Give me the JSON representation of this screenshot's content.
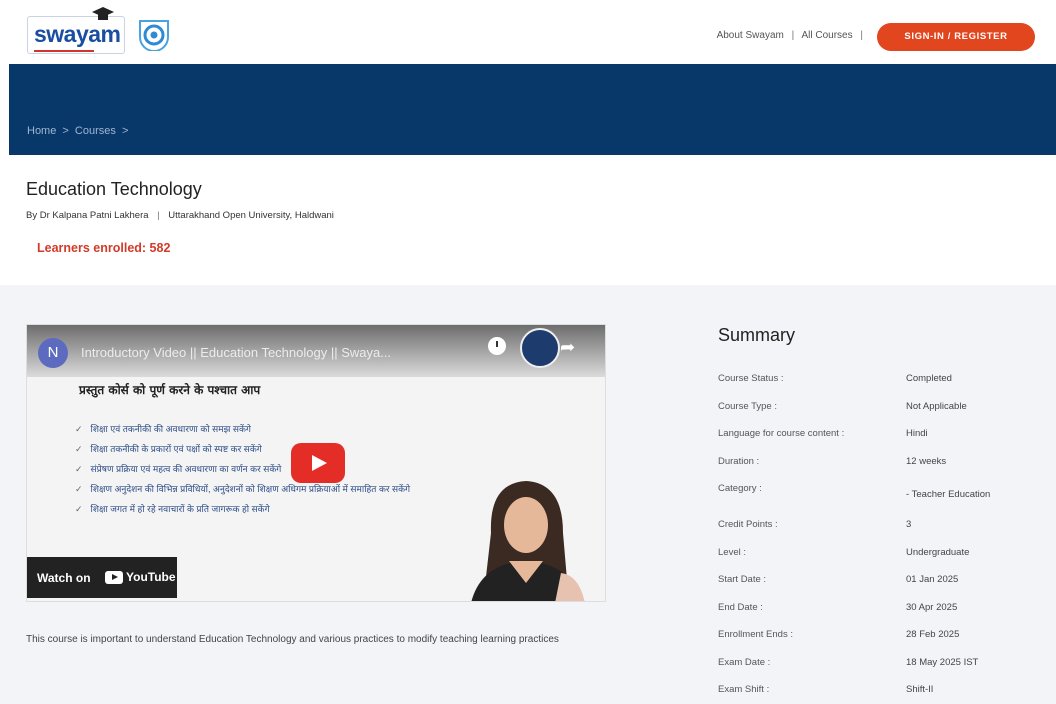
{
  "header": {
    "logo_text": "swayam",
    "nav_about": "About Swayam",
    "nav_sep": "|",
    "nav_courses": "All Courses",
    "signin_label": "SIGN-IN / REGISTER"
  },
  "breadcrumb": {
    "home": "Home",
    "sep1": ">",
    "courses": "Courses",
    "sep2": ">"
  },
  "course": {
    "title": "Education Technology",
    "instructor": "By Dr Kalpana Patni Lakhera",
    "institution": "Uttarakhand Open University, Haldwani",
    "enrolled": "Learners enrolled: 582",
    "description": "This course is important to understand Education Technology and various practices to modify teaching learning practices"
  },
  "video": {
    "channel_initial": "N",
    "title": "Introductory Video || Education Technology || Swaya...",
    "slide_heading": "प्रस्तुत कोर्स को पूर्ण करने के पश्चात आप",
    "bullets": [
      "शिक्षा एवं तकनीकी की अवधारणा को समझ सकेंगे",
      "शिक्षा तकनीकी के प्रकारों एवं पक्षों को स्पष्ट कर सकेंगे",
      "संप्रेषण प्रक्रिया एवं महत्व की अवधारणा का वर्णन कर सकेंगे",
      "शिक्षण अनुदेशन की विभिन्न प्रविधियों, अनुदेशनों को शिक्षण अधिगम प्रक्रियाओं में समाहित कर सकेंगे",
      "शिक्षा जगत में हो रहे नवाचारों के प्रति जागरूक हो सकेंगे"
    ],
    "watch_on": "Watch on",
    "youtube": "YouTube"
  },
  "summary": {
    "title": "Summary",
    "rows": [
      {
        "key": "Course Status :",
        "value": "Completed"
      },
      {
        "key": "Course Type :",
        "value": "Not Applicable"
      },
      {
        "key": "Language for course content :",
        "value": "Hindi"
      },
      {
        "key": "Duration :",
        "value": "12 weeks"
      },
      {
        "key": "Category :",
        "value": "- Teacher Education"
      },
      {
        "key": "Credit Points :",
        "value": "3"
      },
      {
        "key": "Level :",
        "value": "Undergraduate"
      },
      {
        "key": "Start Date :",
        "value": "01 Jan 2025"
      },
      {
        "key": "End Date :",
        "value": "30 Apr 2025"
      },
      {
        "key": "Enrollment Ends :",
        "value": "28 Feb 2025"
      },
      {
        "key": "Exam Date :",
        "value": "18 May 2025 IST"
      },
      {
        "key": "Exam Shift :",
        "value": "Shift-II"
      }
    ]
  },
  "colors": {
    "banner": "#08386a",
    "accent": "#e1461f",
    "enrolled": "#d23a2a"
  }
}
